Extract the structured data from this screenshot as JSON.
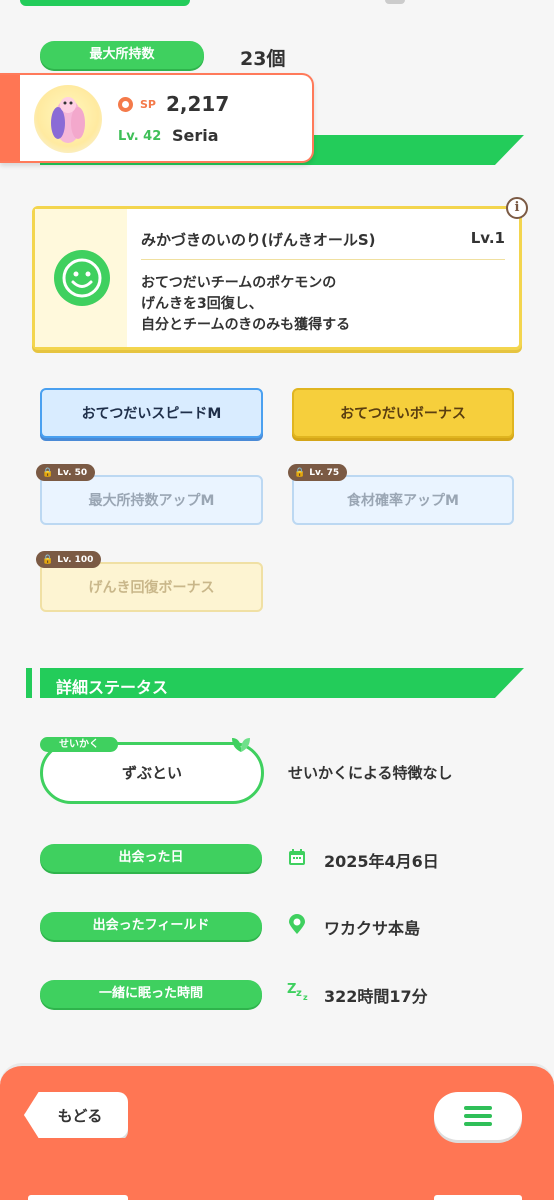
{
  "top": {
    "max_carry_label": "最大所持数",
    "max_carry_value": "23個"
  },
  "profile": {
    "sp_label": "SP",
    "sp_value": "2,217",
    "level": "Lv. 42",
    "name": "Seria"
  },
  "main_skill": {
    "name": "みかづきのいのり(げんきオールS)",
    "level": "Lv.1",
    "desc_line1": "おてつだいチームのポケモンの",
    "desc_line2": "げんきを3回復し、",
    "desc_line3": "自分とチームのきのみも獲得する",
    "info_icon": "info-icon"
  },
  "sub_skills": [
    {
      "label": "おてつだいスピードM",
      "locked": false
    },
    {
      "label": "おてつだいボーナス",
      "locked": false
    },
    {
      "label": "最大所持数アップM",
      "lock_level": "Lv. 50"
    },
    {
      "label": "食材確率アップM",
      "lock_level": "Lv. 75"
    },
    {
      "label": "げんき回復ボーナス",
      "lock_level": "Lv. 100"
    }
  ],
  "details": {
    "section_title": "詳細ステータス",
    "nature_tag": "せいかく",
    "nature_value": "ずぶとい",
    "nature_effect": "せいかくによる特徴なし",
    "met_date_label": "出会った日",
    "met_date_value": "2025年4月6日",
    "met_field_label": "出会ったフィールド",
    "met_field_value": "ワカクサ本島",
    "slept_label": "一緒に眠った時間",
    "slept_value": "322時間17分"
  },
  "footer": {
    "back_label": "もどる",
    "menu_icon": "menu-icon"
  },
  "colors": {
    "green": "#3fd05f",
    "section_green": "#23cc5a",
    "orange": "#ff7654",
    "blue_btn": "#d9ecff",
    "yellow_btn": "#f6cf3c"
  }
}
